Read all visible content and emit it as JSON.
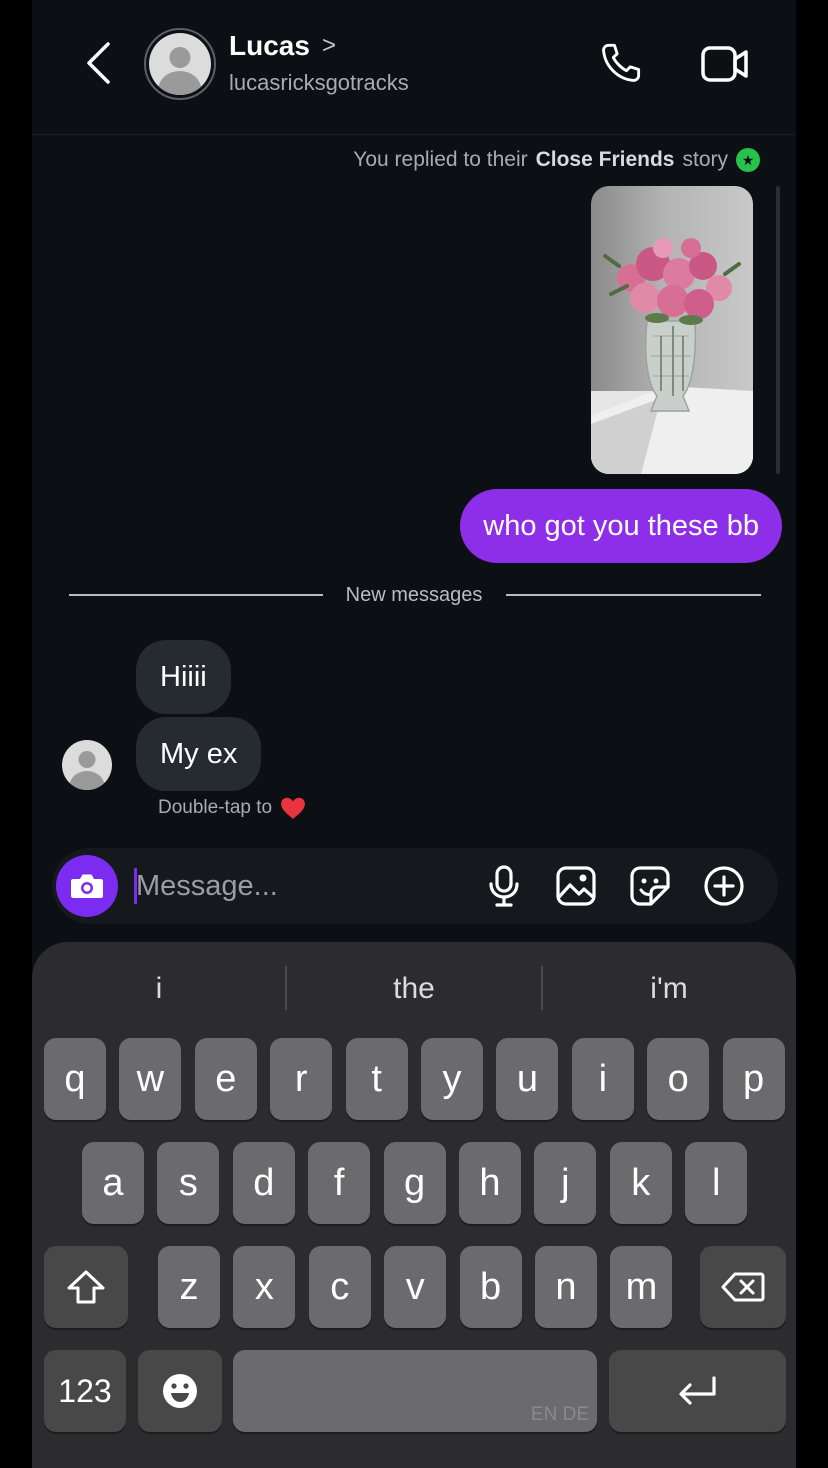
{
  "header": {
    "back_icon": "chevron-left-icon",
    "contact_name": "Lucas",
    "name_chevron": ">",
    "username": "lucasricksgotracks",
    "call_icon": "phone-icon",
    "video_icon": "video-camera-icon"
  },
  "story_reply": {
    "prefix": "You replied to their",
    "highlight": "Close Friends",
    "suffix": "story",
    "badge_icon": "star-icon",
    "badge_glyph": "★",
    "badge_color": "#27c24c"
  },
  "messages": {
    "sent": [
      {
        "text": "who got you these bb"
      }
    ],
    "new_messages_label": "New messages",
    "received": [
      {
        "text": "Hiiii"
      },
      {
        "text": "My ex"
      }
    ],
    "double_tap_hint": "Double-tap to"
  },
  "composer": {
    "placeholder": "Message...",
    "value": "",
    "camera_icon": "camera-icon",
    "mic_icon": "microphone-icon",
    "gallery_icon": "image-icon",
    "sticker_icon": "sticker-icon",
    "add_icon": "plus-circle-icon"
  },
  "keyboard": {
    "suggestions": [
      "i",
      "the",
      "i'm"
    ],
    "row1": [
      "q",
      "w",
      "e",
      "r",
      "t",
      "y",
      "u",
      "i",
      "o",
      "p"
    ],
    "row2": [
      "a",
      "s",
      "d",
      "f",
      "g",
      "h",
      "j",
      "k",
      "l"
    ],
    "row3": [
      "z",
      "x",
      "c",
      "v",
      "b",
      "n",
      "m"
    ],
    "numbers_label": "123",
    "language_label": "EN DE",
    "shift_icon": "shift-icon",
    "backspace_icon": "backspace-icon",
    "emoji_icon": "emoji-icon",
    "return_icon": "return-icon"
  },
  "colors": {
    "accent": "#8d2ee8",
    "background": "#0c0f14",
    "received_bubble": "#262a31"
  }
}
